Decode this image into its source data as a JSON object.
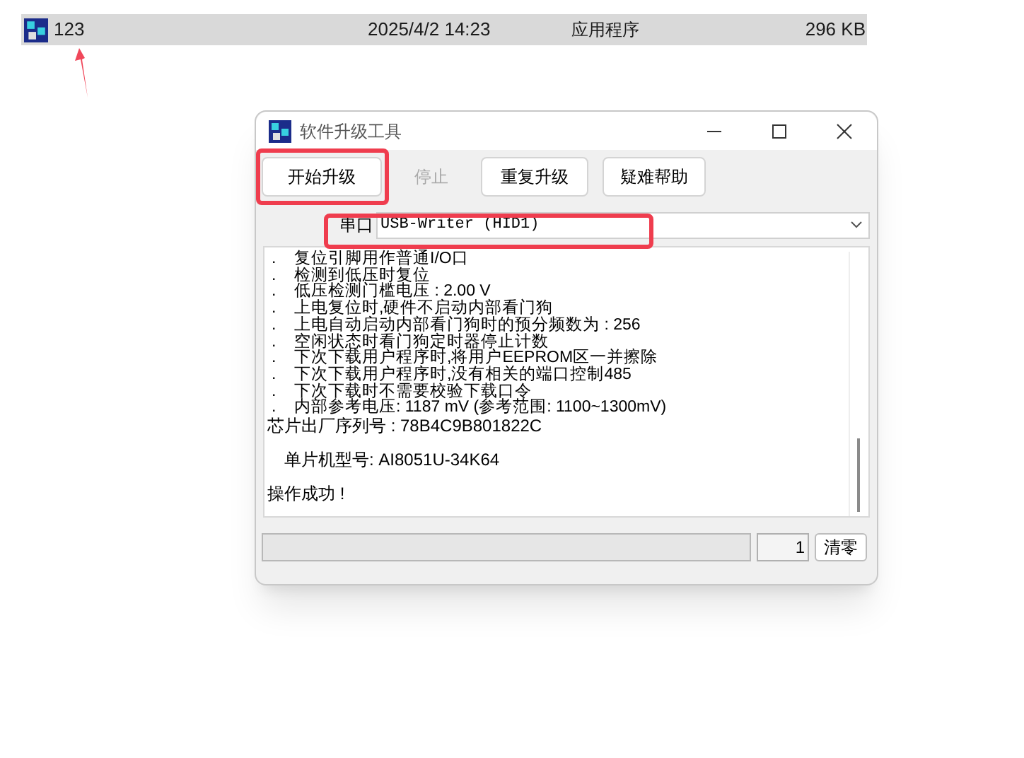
{
  "file_row": {
    "name": "123",
    "modified": "2025/4/2 14:23",
    "type": "应用程序",
    "size": "296 KB",
    "selected": true
  },
  "dialog": {
    "title": "软件升级工具",
    "buttons": [
      {
        "label": "开始升级",
        "disabled": false
      },
      {
        "label": "停止",
        "disabled": true
      },
      {
        "label": "重复升级",
        "disabled": false
      },
      {
        "label": "疑难帮助",
        "disabled": false
      }
    ],
    "port": {
      "label": "串口",
      "value": "USB-Writer (HID1)"
    },
    "log": [
      {
        "kind": "bullet",
        "marker": ".",
        "text": "复位引脚用作普通I/O口"
      },
      {
        "kind": "bullet",
        "marker": ".",
        "text": "检测到低压时复位"
      },
      {
        "kind": "bullet",
        "marker": ".",
        "text": "低压检测门槛电压 : 2.00 V"
      },
      {
        "kind": "bullet",
        "marker": ".",
        "text": "上电复位时,硬件不启动内部看门狗"
      },
      {
        "kind": "bullet",
        "marker": ".",
        "text": "上电自动启动内部看门狗时的预分频数为 : 256"
      },
      {
        "kind": "bullet",
        "marker": ".",
        "text": "空闲状态时看门狗定时器停止计数"
      },
      {
        "kind": "bullet",
        "marker": ".",
        "text": "下次下载用户程序时,将用户EEPROM区一并擦除"
      },
      {
        "kind": "bullet",
        "marker": ".",
        "text": "下次下载用户程序时,没有相关的端口控制485"
      },
      {
        "kind": "bullet",
        "marker": ".",
        "text": "下次下载时不需要校验下载口令"
      },
      {
        "kind": "bullet",
        "marker": ".",
        "text": "内部参考电压: 1187 mV (参考范围: 1100~1300mV)"
      },
      {
        "kind": "plain",
        "text": "芯片出厂序列号 : 78B4C9B801822C"
      },
      {
        "kind": "gap"
      },
      {
        "kind": "indent",
        "text": "单片机型号: AI8051U-34K64"
      },
      {
        "kind": "gap"
      },
      {
        "kind": "plain",
        "text": "操作成功 !"
      }
    ],
    "count": "1",
    "clear_button": "清零"
  }
}
